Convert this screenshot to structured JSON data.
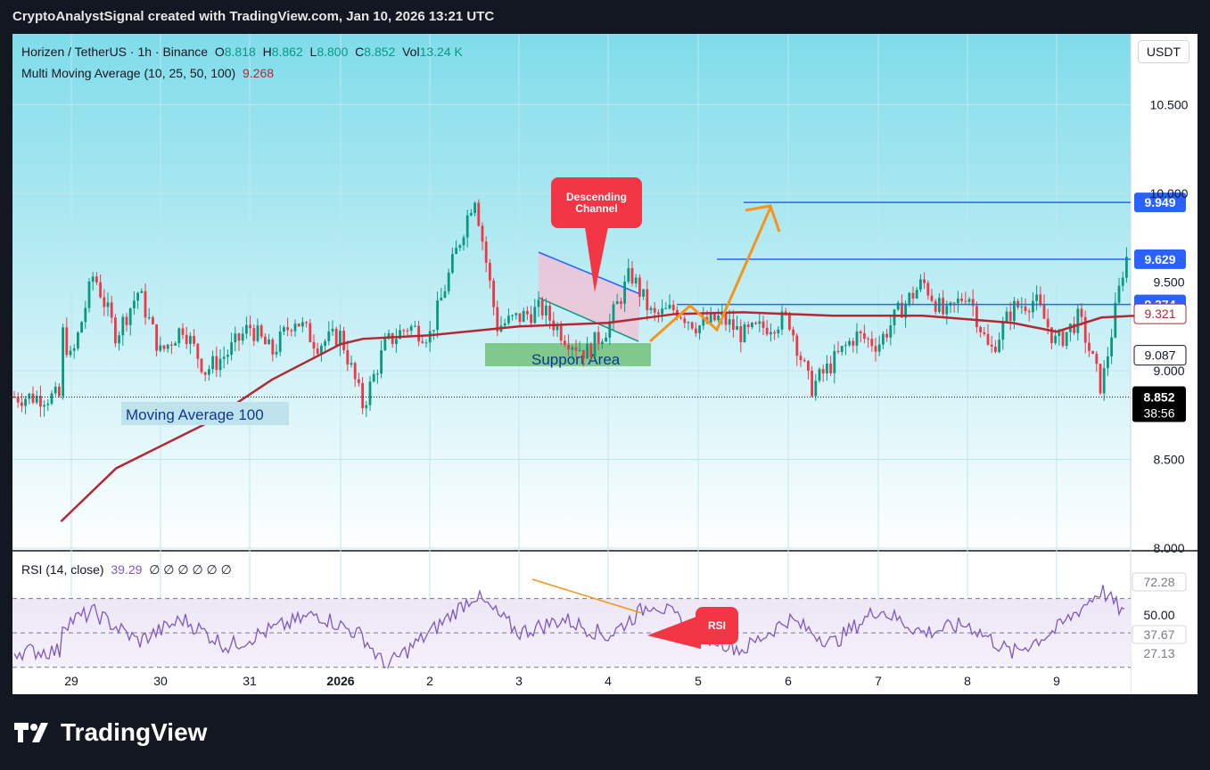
{
  "header": {
    "title": "CryptoAnalystSignal created with TradingView.com, Jan 10, 2026 13:21 UTC"
  },
  "legend": {
    "symbol": "Horizen / TetherUS · 1h · Binance",
    "o_label": "O",
    "o": "8.818",
    "h_label": "H",
    "h": "8.862",
    "l_label": "L",
    "l": "8.800",
    "c_label": "C",
    "c": "8.852",
    "vol_label": "Vol",
    "vol": "13.24 K",
    "ma_label": "Multi Moving Average (10, 25, 50, 100)",
    "ma_value": "9.268"
  },
  "currency_button": "USDT",
  "rsi_legend": {
    "label": "RSI (14, close)",
    "value": "39.29",
    "extras": "∅ ∅ ∅ ∅ ∅ ∅"
  },
  "footer": {
    "brand": "TradingView"
  },
  "colors": {
    "up": "#089981",
    "down": "#f23645",
    "ma": "#b22833",
    "rsi": "#7e57c2",
    "level": "#2962ff",
    "arrow": "#f7931a",
    "background_top": "#7fdcea",
    "background_bottom": "#ffffff"
  },
  "annotations": {
    "descending_channel": "Descending\nChannel",
    "support_area": "Support Area",
    "moving_average": "Moving Average 100",
    "rsi_tag": "RSI"
  },
  "chart_data": [
    {
      "type": "candlestick",
      "title": "Horizen / TetherUS · 1h · Binance",
      "x_tick_labels": [
        "29",
        "30",
        "31",
        "2026",
        "2",
        "3",
        "4",
        "5",
        "6",
        "7",
        "8",
        "9"
      ],
      "y_ticks": [
        8.0,
        8.5,
        9.0,
        9.5,
        10.0,
        10.5
      ],
      "y_tick_labels": [
        "8.000",
        "8.500",
        "9.000",
        "9.500",
        "10.000",
        "10.500"
      ],
      "ylim": [
        8.0,
        10.9
      ],
      "horizontal_levels": [
        {
          "value": 9.949,
          "label": "9.949"
        },
        {
          "value": 9.629,
          "label": "9.629"
        },
        {
          "value": 9.374,
          "label": "9.374"
        }
      ],
      "price_labels": [
        {
          "value": 9.321,
          "label": "9.321",
          "kind": "ma"
        },
        {
          "value": 9.087,
          "label": "9.087",
          "kind": "level"
        },
        {
          "value": 8.852,
          "label": "8.852",
          "sub": "38:56",
          "kind": "last"
        }
      ],
      "close_series": {
        "x": [
          "Dec 28 18:00",
          "Dec 29 00:00",
          "Dec 29 06:00",
          "Dec 29 12:00",
          "Dec 29 18:00",
          "Dec 30 00:00",
          "Dec 30 06:00",
          "Dec 30 12:00",
          "Dec 30 18:00",
          "Dec 31 00:00",
          "Dec 31 06:00",
          "Dec 31 12:00",
          "Dec 31 18:00",
          "Jan 1 00:00",
          "Jan 1 06:00",
          "Jan 1 12:00",
          "Jan 1 18:00",
          "Jan 2 00:00",
          "Jan 2 06:00",
          "Jan 2 12:00",
          "Jan 2 18:00",
          "Jan 3 00:00",
          "Jan 3 06:00",
          "Jan 3 12:00",
          "Jan 3 18:00",
          "Jan 4 00:00",
          "Jan 4 06:00",
          "Jan 4 12:00",
          "Jan 4 18:00",
          "Jan 5 00:00",
          "Jan 5 06:00",
          "Jan 5 12:00",
          "Jan 5 18:00",
          "Jan 6 00:00",
          "Jan 6 06:00",
          "Jan 6 12:00",
          "Jan 6 18:00",
          "Jan 7 00:00",
          "Jan 7 06:00",
          "Jan 7 12:00",
          "Jan 7 18:00",
          "Jan 8 00:00",
          "Jan 8 06:00",
          "Jan 8 12:00",
          "Jan 8 18:00",
          "Jan 9 00:00",
          "Jan 9 06:00",
          "Jan 9 12:00",
          "Jan 9 18:00",
          "Jan 10 00:00",
          "Jan 10 06:00",
          "Jan 10 12:00"
        ],
        "values": [
          9.25,
          9.05,
          9.55,
          9.2,
          9.45,
          9.1,
          9.25,
          9.0,
          9.1,
          9.25,
          9.1,
          9.3,
          9.15,
          9.2,
          8.8,
          9.15,
          9.25,
          9.2,
          9.6,
          10.0,
          9.25,
          9.3,
          9.35,
          9.2,
          9.1,
          9.25,
          9.55,
          9.3,
          9.35,
          9.25,
          9.3,
          9.2,
          9.25,
          9.3,
          8.9,
          9.05,
          9.2,
          9.15,
          9.35,
          9.5,
          9.3,
          9.45,
          9.1,
          9.35,
          9.4,
          9.15,
          9.3,
          8.9,
          9.6,
          9.9,
          9.3,
          8.852
        ]
      },
      "moving_average_100": {
        "x": [
          "Dec 28 18:00",
          "Dec 29 12:00",
          "Dec 30 12:00",
          "Dec 31 06:00",
          "Jan 1 00:00",
          "Jan 1 06:00",
          "Jan 2 00:00",
          "Jan 3 00:00",
          "Jan 4 00:00",
          "Jan 4 18:00",
          "Jan 5 12:00",
          "Jan 6 12:00",
          "Jan 7 12:00",
          "Jan 8 12:00",
          "Jan 9 00:00",
          "Jan 9 12:00",
          "Jan 10 06:00"
        ],
        "values": [
          8.15,
          8.45,
          8.7,
          8.95,
          9.15,
          9.18,
          9.2,
          9.25,
          9.27,
          9.32,
          9.33,
          9.31,
          9.31,
          9.27,
          9.22,
          9.3,
          9.32
        ]
      }
    },
    {
      "type": "line",
      "title": "RSI (14, close)",
      "y_tick_labels": [
        "72.28",
        "50.00",
        "37.67",
        "27.13"
      ],
      "levels": [
        70,
        50,
        30
      ],
      "ylim": [
        20,
        90
      ],
      "series": [
        {
          "name": "RSI (14, close)",
          "x": [
            "Dec 28 18:00",
            "Dec 29 06:00",
            "Dec 29 18:00",
            "Dec 30 06:00",
            "Dec 30 18:00",
            "Dec 31 06:00",
            "Dec 31 18:00",
            "Jan 1 06:00",
            "Jan 1 12:00",
            "Jan 2 00:00",
            "Jan 2 12:00",
            "Jan 3 00:00",
            "Jan 3 12:00",
            "Jan 4 00:00",
            "Jan 4 12:00",
            "Jan 5 00:00",
            "Jan 5 12:00",
            "Jan 6 00:00",
            "Jan 6 12:00",
            "Jan 7 00:00",
            "Jan 7 12:00",
            "Jan 8 00:00",
            "Jan 8 12:00",
            "Jan 9 00:00",
            "Jan 9 12:00",
            "Jan 10 00:00",
            "Jan 10 12:00"
          ],
          "values": [
            55,
            62,
            45,
            58,
            42,
            52,
            61,
            48,
            30,
            50,
            72,
            50,
            58,
            48,
            68,
            50,
            40,
            58,
            44,
            64,
            50,
            55,
            38,
            52,
            75,
            48,
            39.29
          ]
        }
      ]
    }
  ]
}
